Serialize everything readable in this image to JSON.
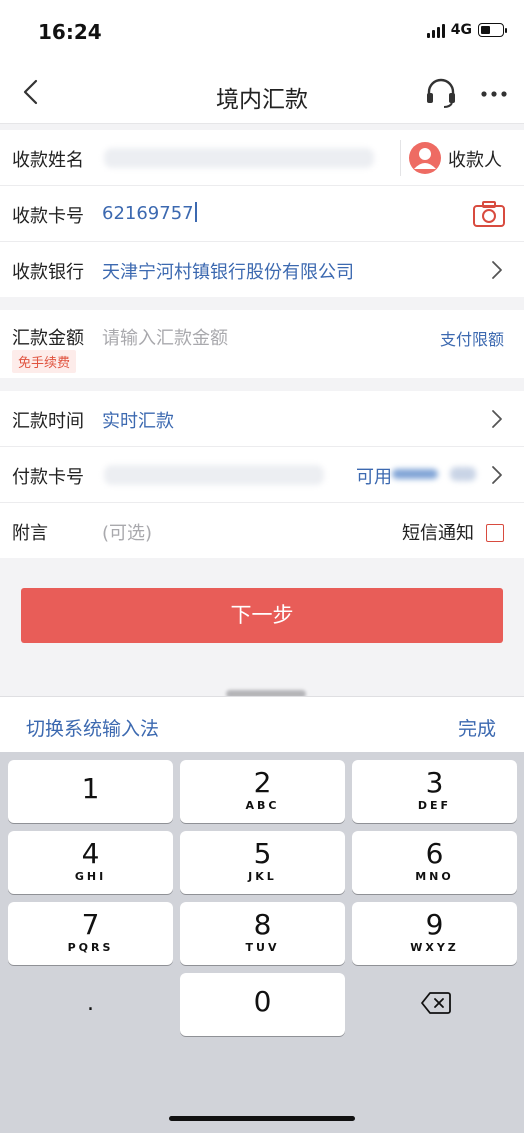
{
  "status_bar": {
    "time": "16:24",
    "network": "4G",
    "battery_level": 0.45
  },
  "nav": {
    "title": "境内汇款",
    "back_icon": "chevron-left-icon",
    "service_icon": "headset-icon",
    "more_icon": "more-dots-icon"
  },
  "form": {
    "payee_name": {
      "label": "收款姓名",
      "recipient_label": "收款人"
    },
    "card_number": {
      "label": "收款卡号",
      "value": "62169757"
    },
    "bank": {
      "label": "收款银行",
      "value": "天津宁河村镇银行股份有限公司"
    },
    "amount": {
      "label": "汇款金额",
      "placeholder": "请输入汇款金额",
      "fee_badge": "免手续费",
      "limit_link": "支付限额"
    },
    "time": {
      "label": "汇款时间",
      "value": "实时汇款"
    },
    "pay_card": {
      "label": "付款卡号",
      "available": "可用"
    },
    "note": {
      "label": "附言",
      "placeholder": "(可选)",
      "sms_label": "短信通知",
      "sms_checked": false
    }
  },
  "next_button": "下一步",
  "keyboard": {
    "switch_label": "切换系统输入法",
    "done_label": "完成",
    "keys": [
      {
        "num": "1",
        "sub": ""
      },
      {
        "num": "2",
        "sub": "ABC"
      },
      {
        "num": "3",
        "sub": "DEF"
      },
      {
        "num": "4",
        "sub": "GHI"
      },
      {
        "num": "5",
        "sub": "JKL"
      },
      {
        "num": "6",
        "sub": "MNO"
      },
      {
        "num": "7",
        "sub": "PQRS"
      },
      {
        "num": "8",
        "sub": "TUV"
      },
      {
        "num": "9",
        "sub": "WXYZ"
      },
      {
        "num": ".",
        "sub": ""
      },
      {
        "num": "0",
        "sub": ""
      },
      {
        "num": "",
        "sub": "",
        "icon": "backspace-icon"
      }
    ]
  },
  "colors": {
    "accent_blue": "#3c69b0",
    "primary_red": "#e85d58"
  }
}
